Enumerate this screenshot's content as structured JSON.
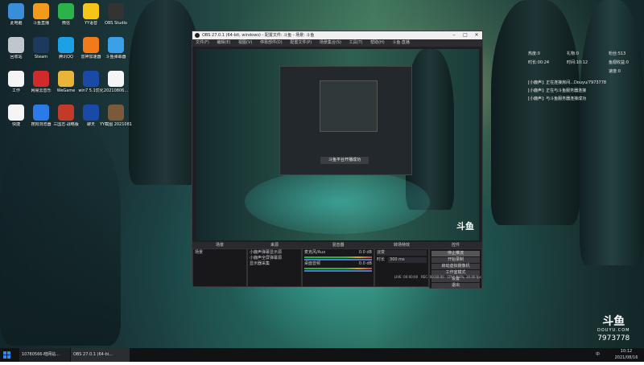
{
  "desktop_icons": [
    {
      "label": "此电脑",
      "color": "#3a8ed8"
    },
    {
      "label": "斗鱼直播",
      "color": "#f29b1a"
    },
    {
      "label": "微信",
      "color": "#2bb34a"
    },
    {
      "label": "YY语音",
      "color": "#f5c518"
    },
    {
      "label": "OBS Studio",
      "color": "#333333"
    },
    {
      "label": "回收站",
      "color": "#bfc6cc"
    },
    {
      "label": "Steam",
      "color": "#1b3a5c"
    },
    {
      "label": "腾讯QQ",
      "color": "#1aa1e6"
    },
    {
      "label": "雷神加速器",
      "color": "#f27a1a"
    },
    {
      "label": "斗鱼弹幕器",
      "color": "#3aa0e8"
    },
    {
      "label": "工作",
      "color": "#f5f5f5"
    },
    {
      "label": "网易云音乐",
      "color": "#d02a2a"
    },
    {
      "label": "WeGame",
      "color": "#e8b53a"
    },
    {
      "label": "win7 5.1优化",
      "color": "#1a4aa8"
    },
    {
      "label": "20210806...",
      "color": "#f5f5f5"
    },
    {
      "label": "快捷",
      "color": "#f5f5f5"
    },
    {
      "label": "搜狗浏览器",
      "color": "#2a7ae8"
    },
    {
      "label": "三国志·战略版",
      "color": "#c23a2a"
    },
    {
      "label": "聊天",
      "color": "#1a4aa8"
    },
    {
      "label": "YY截图 20210810...",
      "color": "#7a5a3a"
    }
  ],
  "obs": {
    "title": "OBS 27.0.1 (64-bit, windows) - 配置文件: 斗鱼 - 场景: 斗鱼",
    "menu": [
      "文件(F)",
      "编辑(E)",
      "视图(V)",
      "停靠部件(D)",
      "配置文件(P)",
      "场景集合(S)",
      "工具(T)",
      "帮助(H)",
      "斗鱼·直播"
    ],
    "preview_toast": "斗鱼平台开播成功",
    "dock_titles": [
      "场景",
      "来源",
      "混音器",
      "转场特效",
      "控件"
    ],
    "scenes": [
      "场景"
    ],
    "sources": [
      "小鹿声弹幕显示源",
      "小鹿声全屏弹幕源",
      "显示器采集"
    ],
    "mixer": [
      {
        "name": "麦克风/Aux",
        "db": "0.0 dB"
      },
      {
        "name": "桌面音频",
        "db": "0.0 dB"
      }
    ],
    "transition": {
      "type": "淡变",
      "duration_label": "时长",
      "duration_value": "300 ms"
    },
    "controls": [
      "停止推流",
      "开始录制",
      "启动虚拟摄像机",
      "工作室模式",
      "设置",
      "退出"
    ],
    "status": {
      "live": "LIVE: 00:00:00",
      "rec": "REC: 00:00:00",
      "cpu": "CPU: 4.3%, 30.00 fps"
    }
  },
  "stats": {
    "hot_label": "热度:",
    "hot_value": "0",
    "gift_label": "礼物:",
    "gift_value": "0",
    "fans_label": "粉丝:",
    "fans_value": "513",
    "duration_label": "时长:",
    "duration_value": "00:24",
    "time_label": "时间:",
    "time_value": "10:12",
    "earn_label": "鱼翅收益:",
    "earn_value": "0",
    "speed_label": "速度:",
    "speed_value": "0"
  },
  "chat": [
    "[小鹿声]: 正在连接房间...Douyu/7973778",
    "[小鹿声]: 正在与斗鱼服务器连接",
    "[小鹿声]: 与斗鱼服务器连接成功"
  ],
  "brand": {
    "logo": "斗鱼",
    "site": "DOUYU.COM",
    "room": "7973778"
  },
  "taskbar": {
    "items": [
      "10780566-暗网站...",
      "OBS 27.0.1 (64-bi..."
    ],
    "time": "10:12",
    "date": "2021/08/16",
    "lang": "中"
  }
}
